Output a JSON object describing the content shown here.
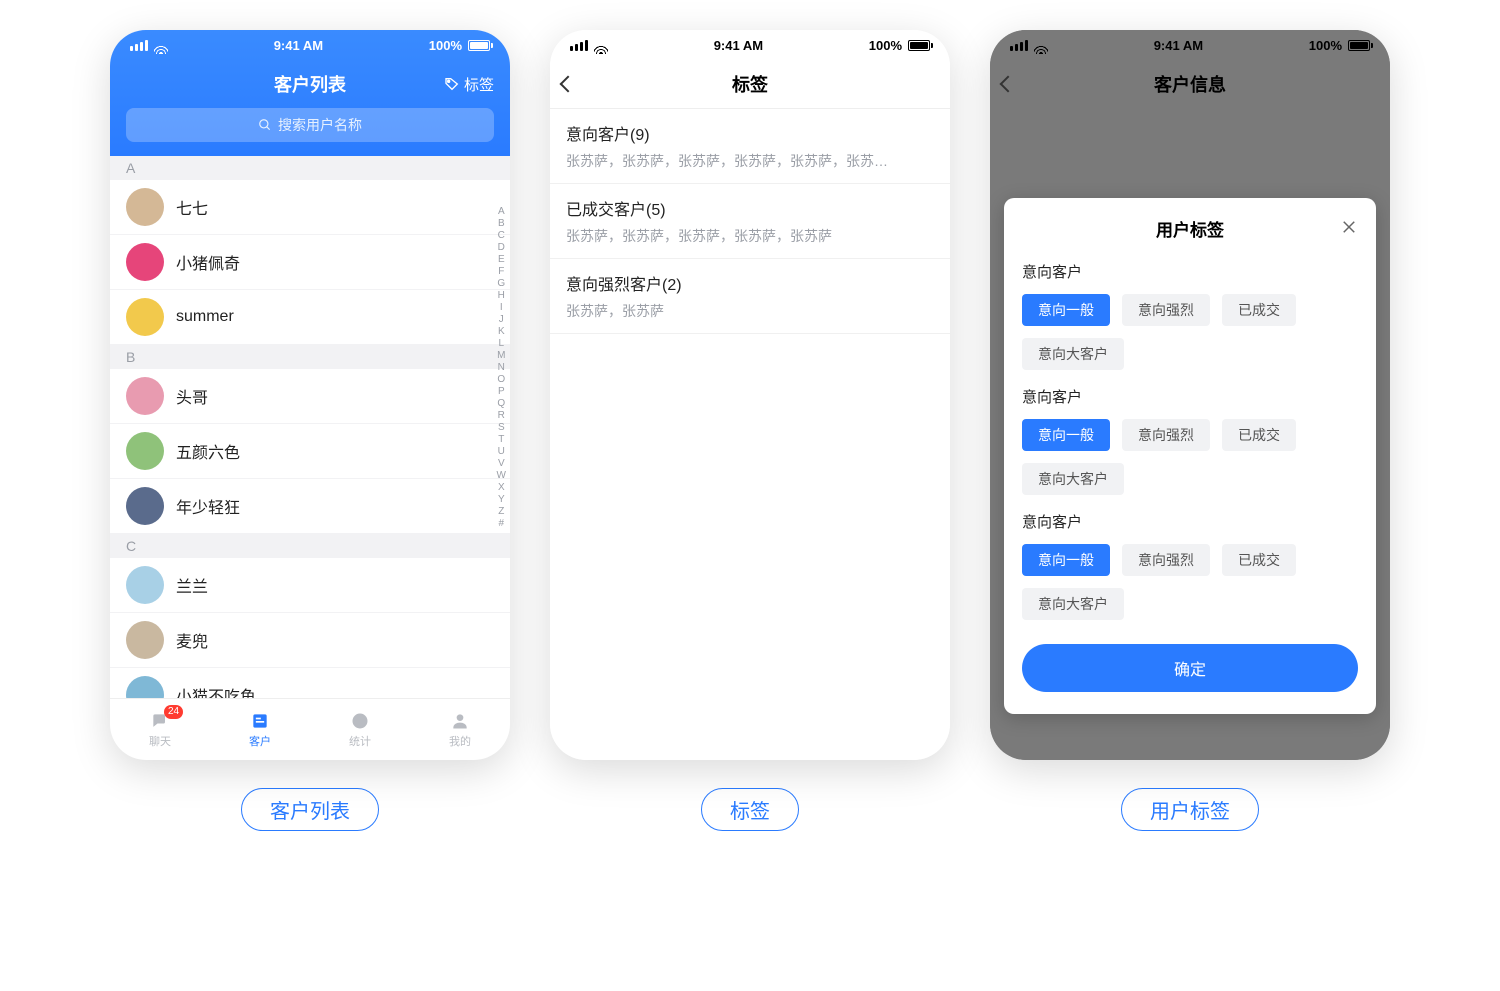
{
  "status": {
    "time": "9:41 AM",
    "battery": "100%"
  },
  "screen1": {
    "title": "客户列表",
    "tag_label": "标签",
    "search_placeholder": "搜索用户名称",
    "sections": [
      {
        "letter": "A",
        "rows": [
          "七七",
          "小猪佩奇",
          "summer"
        ]
      },
      {
        "letter": "B",
        "rows": [
          "头哥",
          "五颜六色",
          "年少轻狂"
        ]
      },
      {
        "letter": "C",
        "rows": [
          "兰兰",
          "麦兜",
          "小猫不吃鱼"
        ]
      }
    ],
    "index_letters": [
      "A",
      "B",
      "C",
      "D",
      "E",
      "F",
      "G",
      "H",
      "I",
      "J",
      "K",
      "L",
      "M",
      "N",
      "O",
      "P",
      "Q",
      "R",
      "S",
      "T",
      "U",
      "V",
      "W",
      "X",
      "Y",
      "Z",
      "#"
    ],
    "tabs": [
      "聊天",
      "客户",
      "统计",
      "我的"
    ],
    "badge": "24",
    "caption": "客户列表"
  },
  "screen2": {
    "title": "标签",
    "groups": [
      {
        "title": "意向客户(9)",
        "sub": "张苏萨，张苏萨，张苏萨，张苏萨，张苏萨，张苏…"
      },
      {
        "title": "已成交客户(5)",
        "sub": "张苏萨，张苏萨，张苏萨，张苏萨，张苏萨"
      },
      {
        "title": "意向强烈客户(2)",
        "sub": "张苏萨，张苏萨"
      }
    ],
    "caption": "标签"
  },
  "screen3": {
    "bg_title": "客户信息",
    "modal_title": "用户标签",
    "groups": [
      {
        "title": "意向客户",
        "chips": [
          {
            "t": "意向一般",
            "on": true
          },
          {
            "t": "意向强烈",
            "on": false
          },
          {
            "t": "已成交",
            "on": false
          },
          {
            "t": "意向大客户",
            "on": false
          }
        ]
      },
      {
        "title": "意向客户",
        "chips": [
          {
            "t": "意向一般",
            "on": true
          },
          {
            "t": "意向强烈",
            "on": false
          },
          {
            "t": "已成交",
            "on": false
          },
          {
            "t": "意向大客户",
            "on": false
          }
        ]
      },
      {
        "title": "意向客户",
        "chips": [
          {
            "t": "意向一般",
            "on": true
          },
          {
            "t": "意向强烈",
            "on": false
          },
          {
            "t": "已成交",
            "on": false
          },
          {
            "t": "意向大客户",
            "on": false
          }
        ]
      }
    ],
    "confirm": "确定",
    "caption": "用户标签"
  },
  "avatar_colors": [
    "#d4b896",
    "#e6457a",
    "#f2c94c",
    "#e89bb0",
    "#8fc27a",
    "#5a6b8c",
    "#a8d0e6",
    "#c9b8a0",
    "#7fb8d6"
  ]
}
